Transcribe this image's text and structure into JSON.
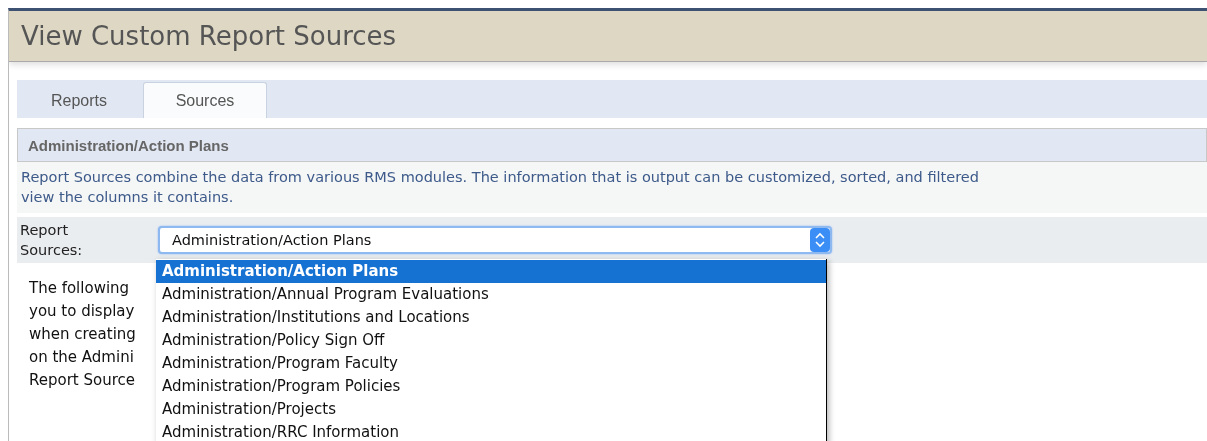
{
  "page_title": "View Custom Report Sources",
  "tabs": [
    {
      "label": "Reports",
      "selected": false
    },
    {
      "label": "Sources",
      "selected": true
    }
  ],
  "section_header": "Administration/Action Plans",
  "description_lines": [
    "Report Sources combine the data from various RMS modules. The information that is output can be customized, sorted, and filtered",
    "view the columns it contains."
  ],
  "report_sources": {
    "label_lines": [
      "Report",
      "Sources:"
    ],
    "value": "Administration/Action Plans",
    "options": [
      {
        "label": "Administration/Action Plans",
        "selected": true
      },
      {
        "label": "Administration/Annual Program Evaluations",
        "selected": false
      },
      {
        "label": "Administration/Institutions and Locations",
        "selected": false
      },
      {
        "label": "Administration/Policy Sign Off",
        "selected": false
      },
      {
        "label": "Administration/Program Faculty",
        "selected": false
      },
      {
        "label": "Administration/Program Policies",
        "selected": false
      },
      {
        "label": "Administration/Projects",
        "selected": false
      },
      {
        "label": "Administration/RRC Information",
        "selected": false
      }
    ]
  },
  "body_lines": [
    "The following",
    "you to display",
    "when creating",
    "on the Admini",
    "Report Source"
  ]
}
